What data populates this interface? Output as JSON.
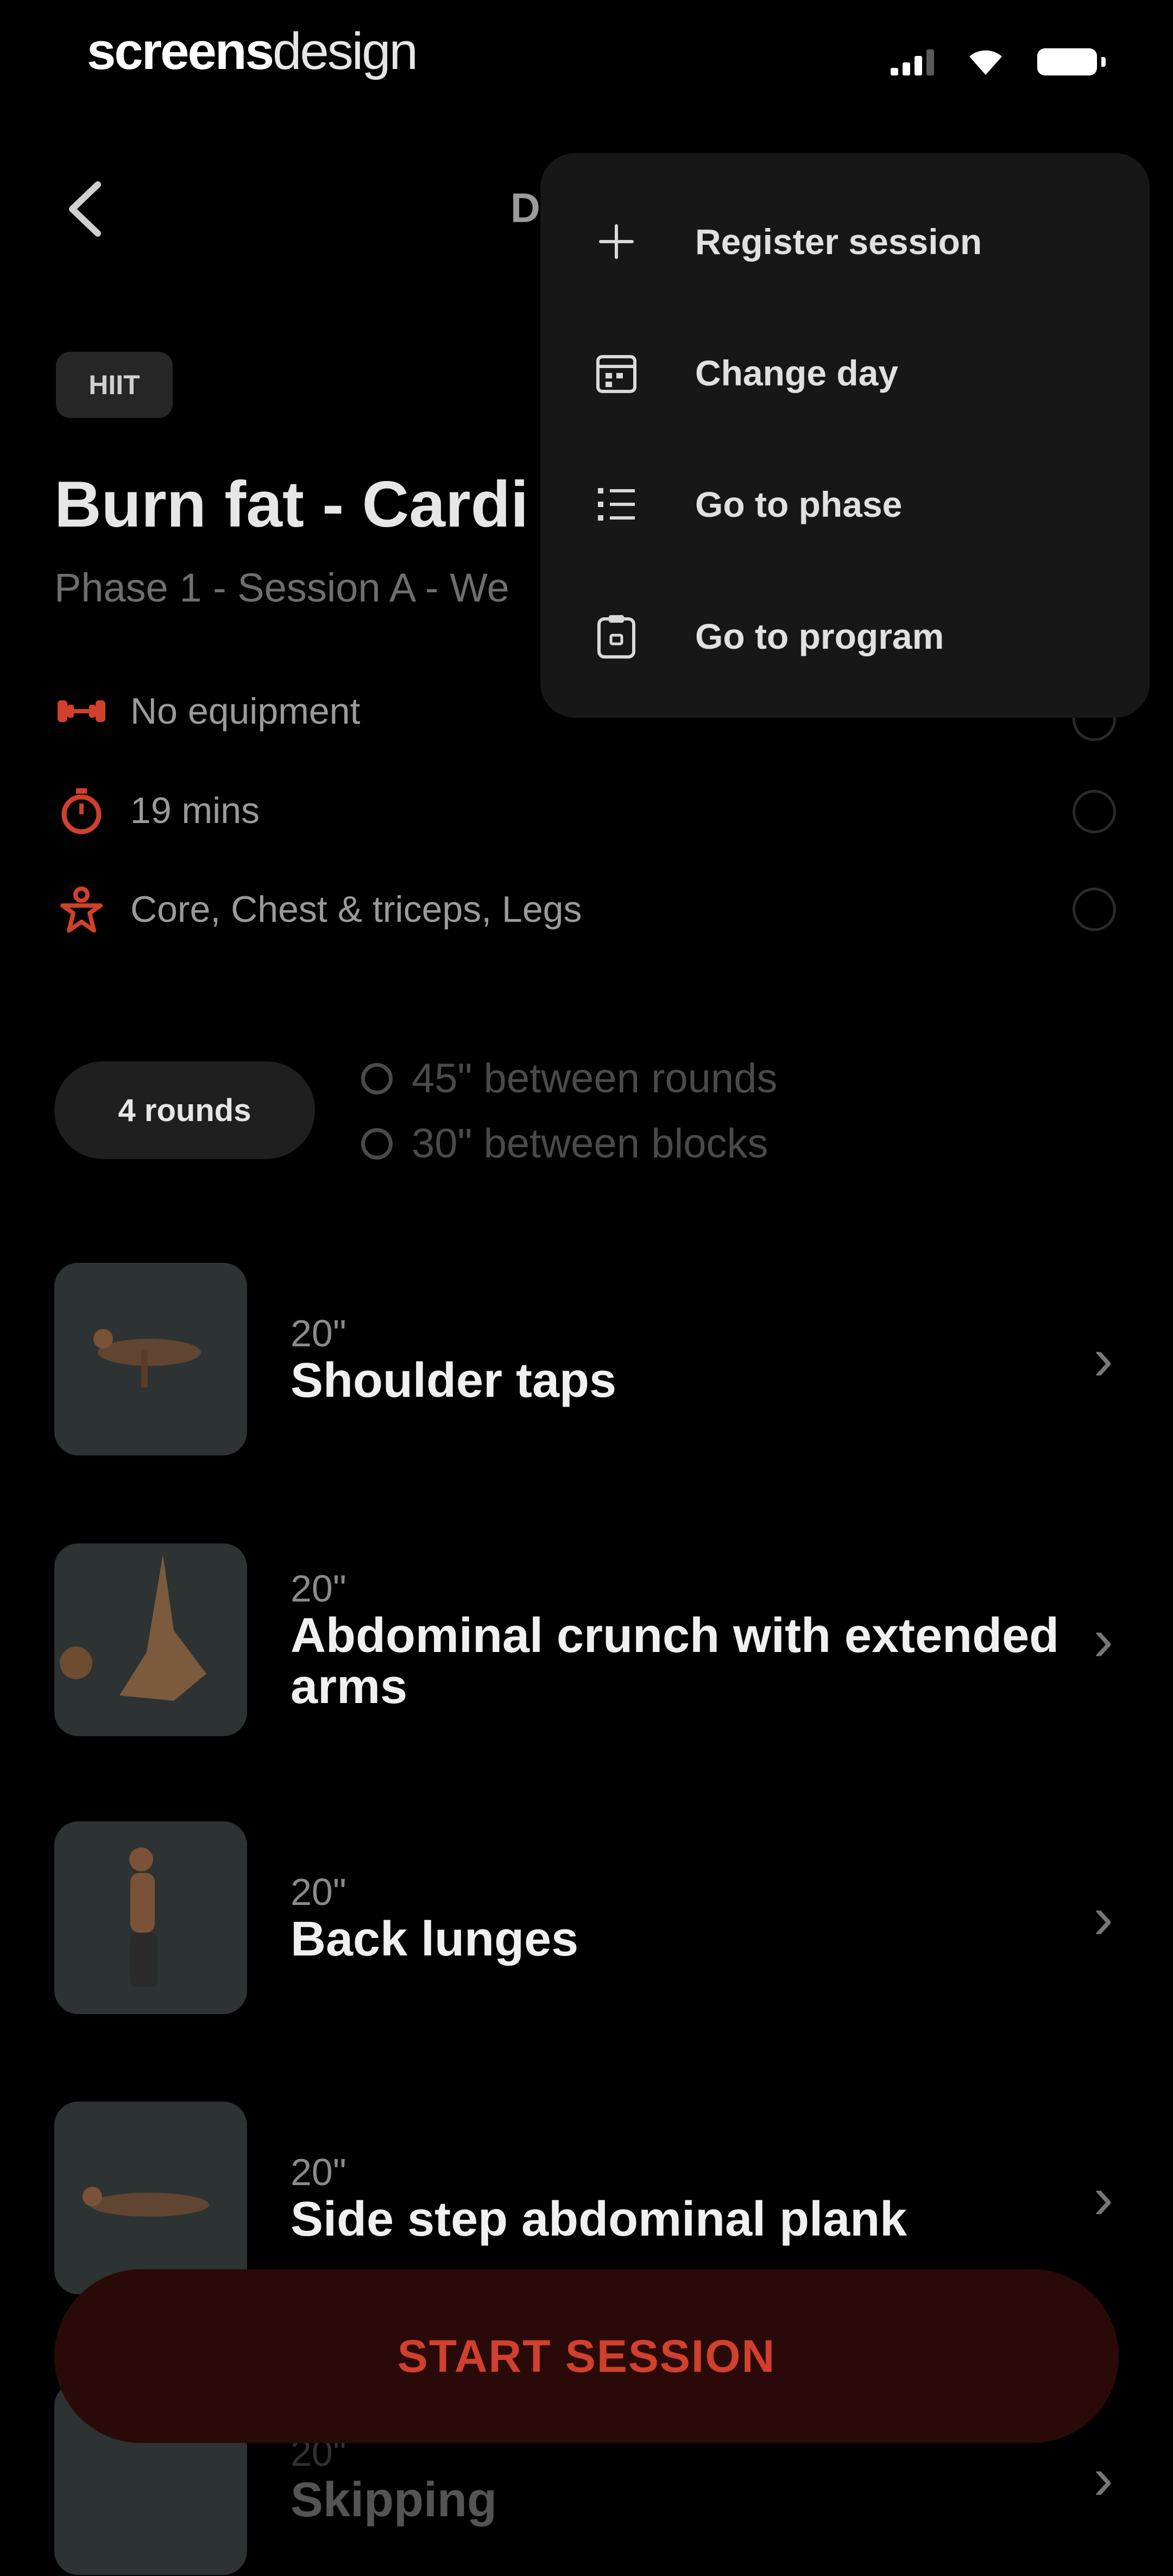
{
  "status_bar": {
    "brand_bold": "screens",
    "brand_regular": "design"
  },
  "header": {
    "back_icon": "chevron-left-icon",
    "title": "D"
  },
  "session": {
    "tag": "HIIT",
    "title": "Burn fat - Cardi",
    "subtitle": "Phase 1 - Session A - We",
    "info": [
      {
        "icon": "dumbbell-icon",
        "text": "No equipment"
      },
      {
        "icon": "stopwatch-icon",
        "text": "19 mins"
      },
      {
        "icon": "muscle-icon",
        "text": "Core, Chest & triceps, Legs"
      }
    ],
    "rounds_label": "4 rounds",
    "rest": [
      {
        "icon": "timer-icon",
        "text": "45\" between rounds"
      },
      {
        "icon": "timer-icon",
        "text": "30\" between blocks"
      }
    ]
  },
  "exercises": [
    {
      "duration": "20\"",
      "name": "Shoulder taps"
    },
    {
      "duration": "20\"",
      "name": "Abdominal crunch with extended arms"
    },
    {
      "duration": "20\"",
      "name": "Back lunges"
    },
    {
      "duration": "20\"",
      "name": "Side step abdominal plank"
    },
    {
      "duration": "20\"",
      "name": "Skipping"
    }
  ],
  "start_button": "START SESSION",
  "menu": {
    "items": [
      {
        "icon": "plus-icon",
        "label": "Register session"
      },
      {
        "icon": "calendar-icon",
        "label": "Change day"
      },
      {
        "icon": "list-icon",
        "label": "Go to phase"
      },
      {
        "icon": "clipboard-icon",
        "label": "Go to program"
      }
    ]
  },
  "colors": {
    "accent": "#d0402d",
    "menu_bg": "#171717",
    "background": "#000000"
  }
}
